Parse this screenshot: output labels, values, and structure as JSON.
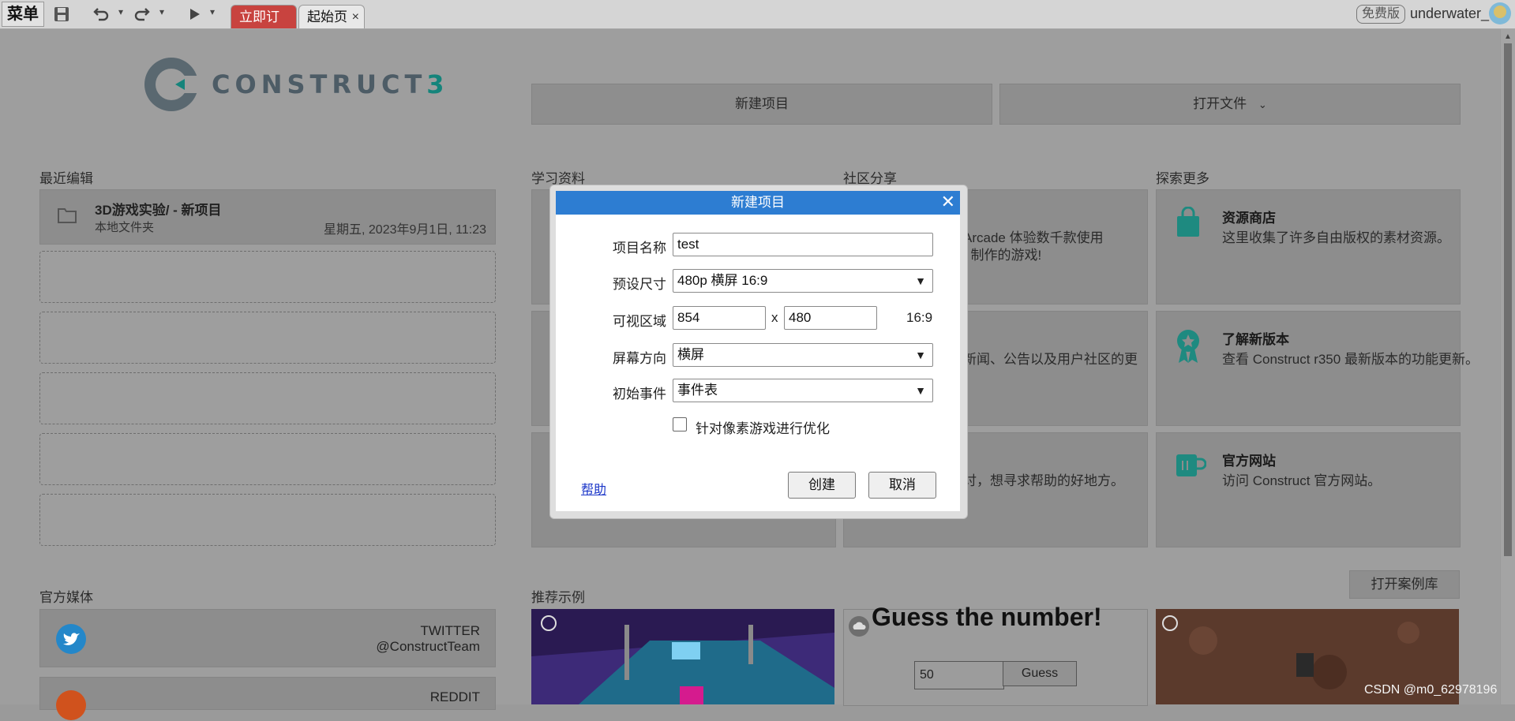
{
  "toolbar": {
    "menu_label": "菜单",
    "tabs": [
      {
        "label": "立即订阅"
      },
      {
        "label": "起始页",
        "close": "×"
      }
    ],
    "plan_badge": "免费版",
    "username": "underwater_"
  },
  "start_page": {
    "logo_text": "CONSTRUCT",
    "logo_number": "3",
    "new_project_button": "新建项目",
    "open_file_button": "打开文件",
    "sections": {
      "recent": "最近编辑",
      "learning": "学习资料",
      "community": "社区分享",
      "explore": "探索更多",
      "media": "官方媒体",
      "examples": "推荐示例"
    },
    "recent_item": {
      "title": "3D游戏实验/ - 新项目",
      "location": "本地文件夹",
      "date": "星期五, 2023年9月1日, 11:23"
    },
    "community_snippets": [
      "Arcade 体验数千款使用",
      "t 制作的游戏!",
      "新闻、公告以及用户社区的更",
      "讨，想寻求帮助的好地方。"
    ],
    "explore_items": [
      {
        "title": "资源商店",
        "desc": "这里收集了许多自由版权的素材资源。",
        "icon": "shopping-bag-icon"
      },
      {
        "title": "了解新版本",
        "desc": "查看 Construct r350 最新版本的功能更新。",
        "icon": "award-ribbon-icon"
      },
      {
        "title": "官方网站",
        "desc": "访问 Construct 官方网站。",
        "icon": "coffee-cup-icon"
      }
    ],
    "social": [
      {
        "name": "TWITTER",
        "handle": "@ConstructTeam",
        "icon": "twitter-icon"
      },
      {
        "name": "REDDIT",
        "icon": "reddit-icon"
      }
    ],
    "open_examples_button": "打开案例库",
    "example_guess": {
      "title": "Guess the number!",
      "input_value": "50",
      "button": "Guess"
    }
  },
  "dialog": {
    "title": "新建项目",
    "fields": {
      "name_label": "项目名称",
      "name_value": "test",
      "preset_label": "预设尺寸",
      "preset_value": "480p 横屏 16:9",
      "viewport_label": "可视区域",
      "viewport_width": "854",
      "viewport_sep": "x",
      "viewport_height": "480",
      "aspect_ratio": "16:9",
      "orientation_label": "屏幕方向",
      "orientation_value": "横屏",
      "first_layout_label": "初始事件",
      "first_layout_value": "事件表",
      "pixel_opt_label": "针对像素游戏进行优化",
      "pixel_opt_checked": false
    },
    "help_link": "帮助",
    "create_button": "创建",
    "cancel_button": "取消"
  },
  "watermark": "CSDN @m0_62978196",
  "colors": {
    "dialog_header": "#2d7dd2",
    "subscribe_tab": "#c8433f",
    "accent_teal": "#15847b"
  }
}
